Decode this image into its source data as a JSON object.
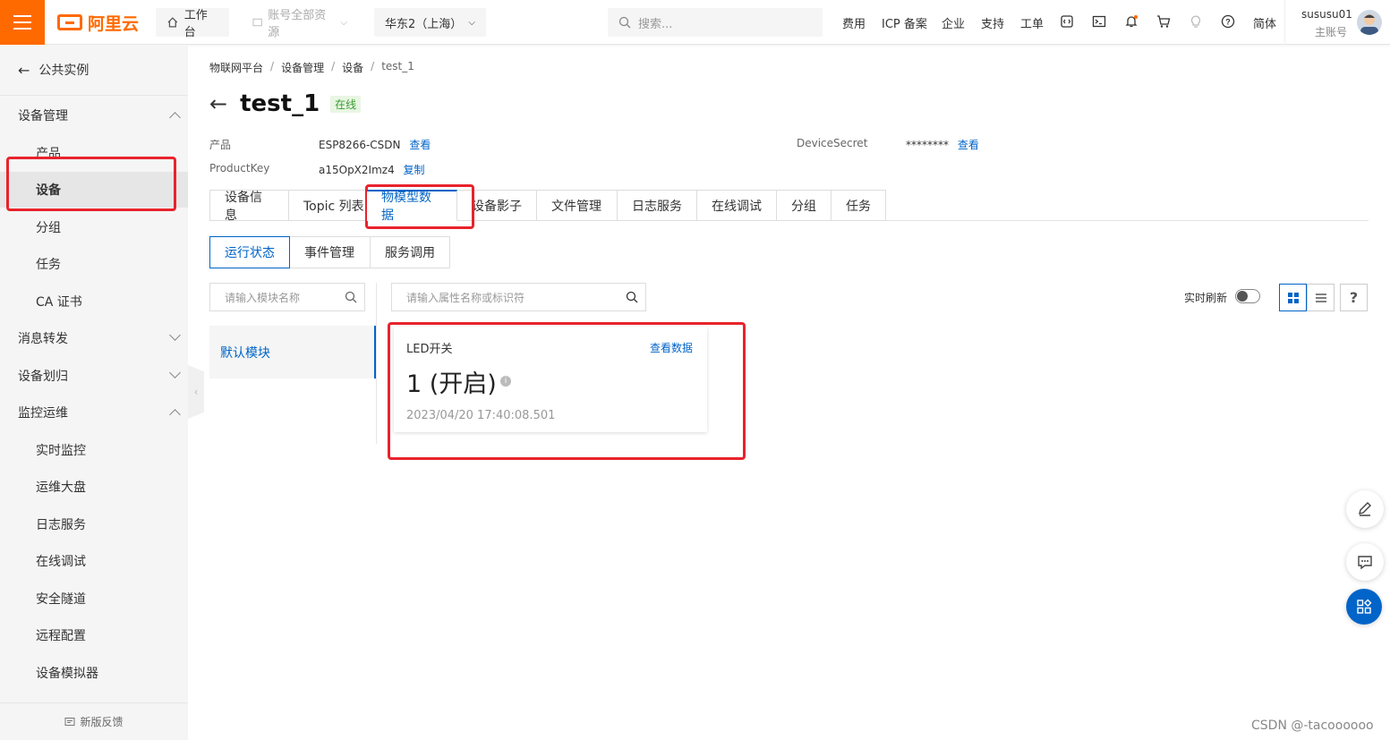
{
  "topbar": {
    "logo": "阿里云",
    "workbench": "工作台",
    "account_resources": "账号全部资源",
    "region": "华东2（上海）",
    "search_placeholder": "搜索...",
    "links": [
      "费用",
      "ICP 备案",
      "企业",
      "支持",
      "工单"
    ],
    "language": "简体",
    "user_name": "sususu01",
    "user_role": "主账号"
  },
  "sidebar": {
    "back_label": "公共实例",
    "items": [
      {
        "label": "设备管理",
        "type": "group"
      },
      {
        "label": "产品",
        "type": "sub"
      },
      {
        "label": "设备",
        "type": "sub"
      },
      {
        "label": "分组",
        "type": "sub"
      },
      {
        "label": "任务",
        "type": "sub"
      },
      {
        "label": "CA 证书",
        "type": "sub"
      },
      {
        "label": "消息转发",
        "type": "group"
      },
      {
        "label": "设备划归",
        "type": "group"
      },
      {
        "label": "监控运维",
        "type": "group"
      },
      {
        "label": "实时监控",
        "type": "sub"
      },
      {
        "label": "运维大盘",
        "type": "sub"
      },
      {
        "label": "日志服务",
        "type": "sub"
      },
      {
        "label": "在线调试",
        "type": "sub"
      },
      {
        "label": "安全隧道",
        "type": "sub"
      },
      {
        "label": "远程配置",
        "type": "sub"
      },
      {
        "label": "设备模拟器",
        "type": "sub"
      }
    ],
    "footer": "新版反馈"
  },
  "breadcrumb": [
    "物联网平台",
    "设备管理",
    "设备",
    "test_1"
  ],
  "device": {
    "title": "test_1",
    "status": "在线",
    "product_label": "产品",
    "product_value": "ESP8266-CSDN",
    "product_link": "查看",
    "productkey_label": "ProductKey",
    "productkey_value": "a15OpX2Imz4",
    "productkey_link": "复制",
    "secret_label": "DeviceSecret",
    "secret_value": "********",
    "secret_link": "查看"
  },
  "tabs": [
    "设备信息",
    "Topic 列表",
    "物模型数据",
    "设备影子",
    "文件管理",
    "日志服务",
    "在线调试",
    "分组",
    "任务"
  ],
  "subtabs": [
    "运行状态",
    "事件管理",
    "服务调用"
  ],
  "module_search_placeholder": "请输入模块名称",
  "property_search_placeholder": "请输入属性名称或标识符",
  "module_default": "默认模块",
  "realtime_refresh": "实时刷新",
  "help": "?",
  "card": {
    "title": "LED开关",
    "link": "查看数据",
    "value": "1 (开启)",
    "info": "i",
    "timestamp": "2023/04/20 17:40:08.501"
  },
  "watermark": "CSDN @-tacoooooo",
  "colors": {
    "accent": "#ff6a00",
    "link": "#0064c8",
    "highlight": "#e8232c",
    "online": "#3a9b32"
  }
}
